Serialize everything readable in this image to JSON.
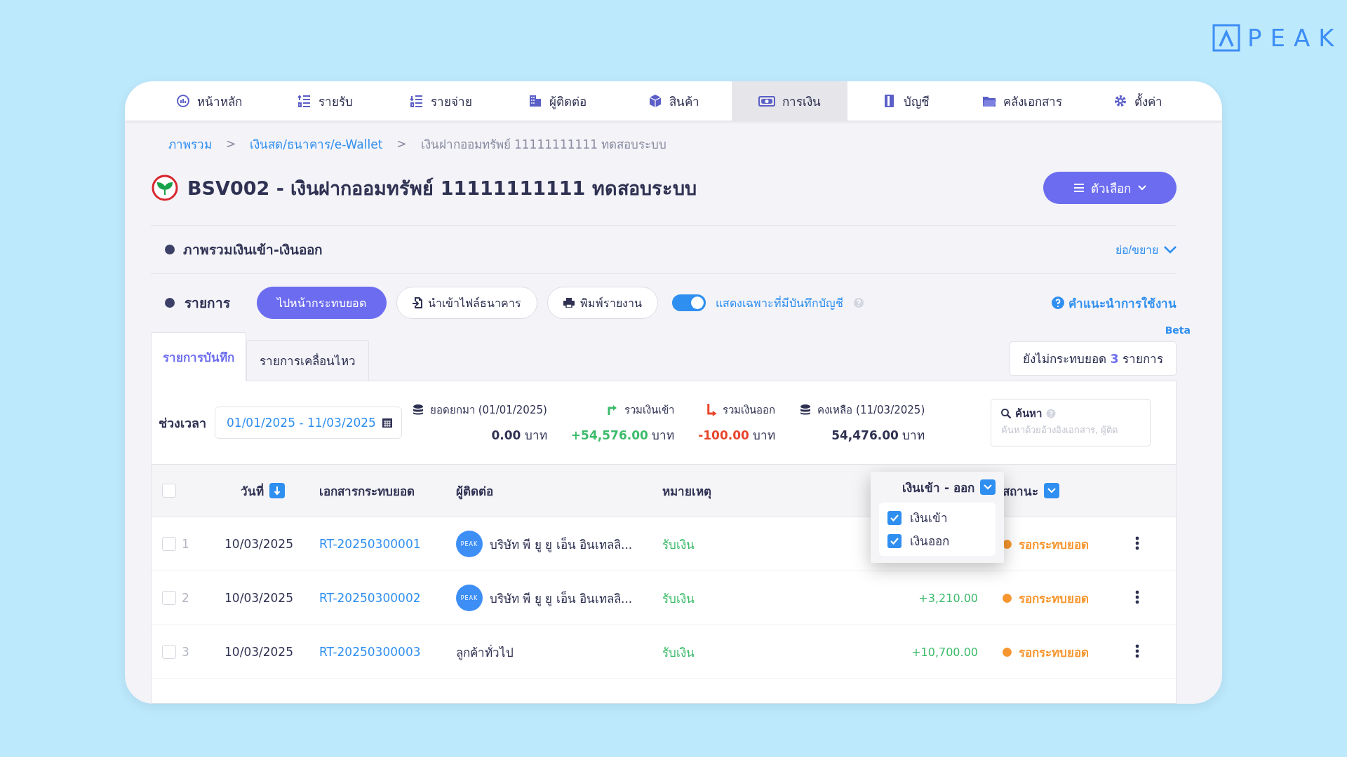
{
  "logo": {
    "text": "PEAK"
  },
  "nav": [
    {
      "label": "หน้าหลัก",
      "selected": false
    },
    {
      "label": "รายรับ",
      "selected": false
    },
    {
      "label": "รายจ่าย",
      "selected": false
    },
    {
      "label": "ผู้ติดต่อ",
      "selected": false
    },
    {
      "label": "สินค้า",
      "selected": false
    },
    {
      "label": "การเงิน",
      "selected": true
    },
    {
      "label": "บัญชี",
      "selected": false
    },
    {
      "label": "คลังเอกสาร",
      "selected": false
    },
    {
      "label": "ตั้งค่า",
      "selected": false
    }
  ],
  "breadcrumb": [
    {
      "label": "ภาพรวม",
      "link": true
    },
    {
      "label": "เงินสด/ธนาคาร/e-Wallet",
      "link": true
    },
    {
      "label": "เงินฝากออมทรัพย์ 11111111111 ทดสอบระบบ",
      "link": false
    }
  ],
  "breadcrumb_separator": ">",
  "title": "BSV002 - เงินฝากออมทรัพย์ 11111111111 ทดสอบระบบ",
  "options_button": "ตัวเลือก",
  "overview": {
    "title": "ภาพรวมเงินเข้า-เงินออก",
    "toggle": "ย่อ/ขยาย"
  },
  "list": {
    "title": "รายการ",
    "buttons": [
      {
        "label": "ไปหน้ากระทบยอด",
        "kind": "primary"
      },
      {
        "label": "นำเข้าไฟล์ธนาคาร",
        "kind": "import"
      },
      {
        "label": "พิมพ์รายงาน",
        "kind": "print"
      }
    ],
    "switch": {
      "label": "แสดงเฉพาะที่มีบันทึกบัญชี",
      "on": true
    },
    "help_link": "คำแนะนำการใช้งาน",
    "beta": "Beta"
  },
  "tabs": [
    {
      "label": "รายการบันทึก",
      "selected": true
    },
    {
      "label": "รายการเคลื่อนไหว",
      "selected": false
    }
  ],
  "unreconciled": "ยังไม่กระทบยอด **3** รายการ",
  "period": {
    "label": "ช่วงเวลา",
    "value": "01/01/2025 - 11/03/2025"
  },
  "totals": [
    {
      "kind": "opening",
      "label": "ยอดยกมา (01/01/2025)",
      "amount": "0.00",
      "unit": "บาท"
    },
    {
      "kind": "in",
      "label": "รวมเงินเข้า",
      "amount": "+54,576.00",
      "unit": "บาท"
    },
    {
      "kind": "out",
      "label": "รวมเงินออก",
      "amount": "-100.00",
      "unit": "บาท"
    },
    {
      "kind": "balance",
      "label": "คงเหลือ (11/03/2025)",
      "amount": "54,476.00",
      "unit": "บาท"
    }
  ],
  "search": {
    "label": "ค้นหา",
    "placeholder": "ค้นหาด้วยอ้างอิงเอกสาร, ผู้ติด"
  },
  "table": {
    "all_selected": false,
    "columns": [
      {
        "label": "วันที่",
        "kind": "sort"
      },
      {
        "label": "เอกสารกระทบยอด",
        "kind": "plain"
      },
      {
        "label": "ผู้ติดต่อ",
        "kind": "plain"
      },
      {
        "label": "หมายเหตุ",
        "kind": "plain"
      },
      {
        "label": "เงินเข้า - ออก",
        "kind": "filter"
      },
      {
        "label": "สถานะ",
        "kind": "filter"
      }
    ],
    "rows": [
      {
        "no": "1",
        "selected": false,
        "date": "10/03/2025",
        "document": "RT-20250300001",
        "avatar": "PEAK",
        "contact": "บริษัท พี ยู ยู เอ็น อินเทลลิ...",
        "note": "รับเงิน",
        "status": "รอกระทบยอด"
      },
      {
        "no": "2",
        "selected": false,
        "date": "10/03/2025",
        "document": "RT-20250300002",
        "avatar": "PEAK",
        "contact": "บริษัท พี ยู ยู เอ็น อินเทลลิ...",
        "note": "รับเงิน",
        "amount": "+3,210.00",
        "status": "รอกระทบยอด"
      },
      {
        "no": "3",
        "selected": false,
        "date": "10/03/2025",
        "document": "RT-20250300003",
        "contact": "ลูกค้าทั่วไป",
        "note": "รับเงิน",
        "amount": "+10,700.00",
        "status": "รอกระทบยอด"
      }
    ]
  },
  "amount_filter": [
    {
      "label": "เงินเข้า",
      "checked": true
    },
    {
      "label": "เงินออก",
      "checked": true
    }
  ]
}
